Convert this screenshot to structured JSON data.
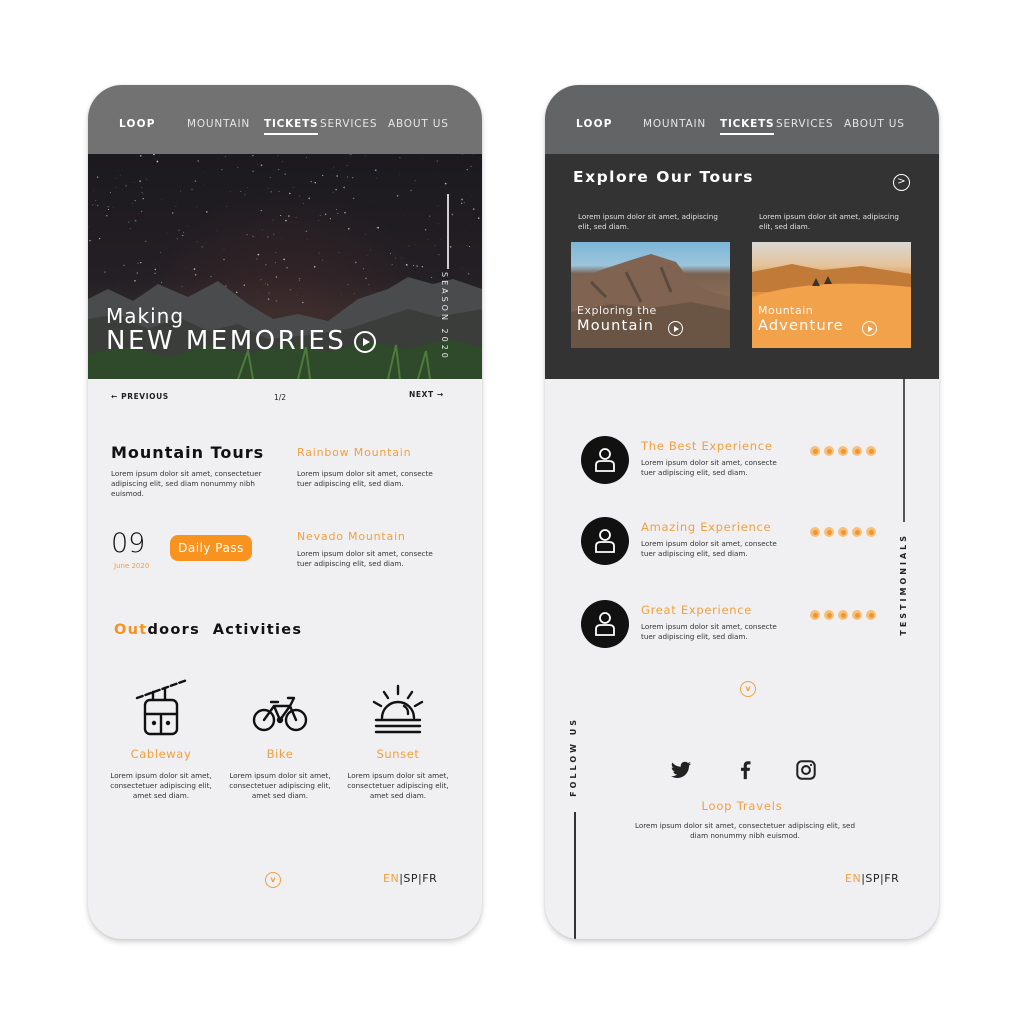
{
  "nav": {
    "logo": "LOOP",
    "items": [
      "MOUNTAIN",
      "TICKETS",
      "SERVICES",
      "ABOUT US"
    ],
    "active": "TICKETS"
  },
  "colors": {
    "accent": "#f7931e",
    "accent_text": "#f0a040",
    "nav_bg": "#727273",
    "dark_panel": "#333333",
    "page_bg": "#f0f0f2"
  },
  "left": {
    "hero": {
      "small": "Making",
      "big": "NEW MEMORIES",
      "side_label": "SEASON 2020",
      "play_icon": "play-circle-icon"
    },
    "pager": {
      "prev": "PREVIOUS",
      "count": "1/2",
      "next": "NEXT"
    },
    "mountain_tours": {
      "title": "Mountain Tours",
      "text": "Lorem ipsum dolor sit amet, consectetuer adipiscing elit, sed diam nonummy nibh euismod."
    },
    "tours": [
      {
        "name": "Rainbow Mountain",
        "text": "Lorem ipsum dolor sit amet, consecte tuer adipiscing elit, sed diam."
      },
      {
        "name": "Nevado Mountain",
        "text": "Lorem ipsum dolor sit amet, consecte tuer adipiscing elit, sed diam."
      }
    ],
    "date": {
      "day": "09",
      "month": "June 2020"
    },
    "daily_pass": "Daily Pass",
    "activities_title": {
      "highlight": "Out",
      "rest": "doors",
      "second": "Activities"
    },
    "activities": [
      {
        "name": "Cableway",
        "icon": "cable-car-icon",
        "text": "Lorem ipsum dolor sit amet, consectetuer adipiscing elit, amet sed diam."
      },
      {
        "name": "Bike",
        "icon": "bicycle-icon",
        "text": "Lorem ipsum dolor sit amet, consectetuer adipiscing elit, amet sed diam."
      },
      {
        "name": "Sunset",
        "icon": "sunset-icon",
        "text": "Lorem ipsum dolor sit amet, consectetuer adipiscing elit, amet sed diam."
      }
    ],
    "scroll_icon": "v",
    "languages": {
      "en": "EN",
      "sep": "|",
      "sp": "SP",
      "fr": "FR"
    }
  },
  "right": {
    "tours_title": "Explore Our Tours",
    "cards": [
      {
        "text": "Lorem ipsum dolor sit amet, adipiscing elit, sed diam.",
        "sub": "Exploring the",
        "main": "Mountain"
      },
      {
        "text": "Lorem ipsum dolor sit amet, adipiscing elit, sed diam.",
        "sub": "Mountain",
        "main": "Adventure"
      }
    ],
    "testimonials_label": "TESTIMONIALS",
    "testimonials": [
      {
        "title": "The Best Experience",
        "text": "Lorem ipsum dolor sit amet, consecte tuer adipiscing elit, sed diam.",
        "rating": 5,
        "max": 5
      },
      {
        "title": "Amazing Experience",
        "text": "Lorem ipsum dolor sit amet, consecte tuer adipiscing elit, sed diam.",
        "rating": 5,
        "max": 5
      },
      {
        "title": "Great Experience",
        "text": "Lorem ipsum dolor sit amet, consecte tuer adipiscing elit, sed diam.",
        "rating": 5,
        "max": 5
      }
    ],
    "scroll_icon": "v",
    "follow_label": "FOLLOW US",
    "social": [
      "twitter-icon",
      "facebook-icon",
      "instagram-icon"
    ],
    "brand_name": "Loop Travels",
    "brand_text": "Lorem ipsum dolor sit amet, consectetuer adipiscing elit, sed diam nonummy nibh euismod.",
    "languages": {
      "en": "EN",
      "sep": "|",
      "sp": "SP",
      "fr": "FR"
    }
  }
}
